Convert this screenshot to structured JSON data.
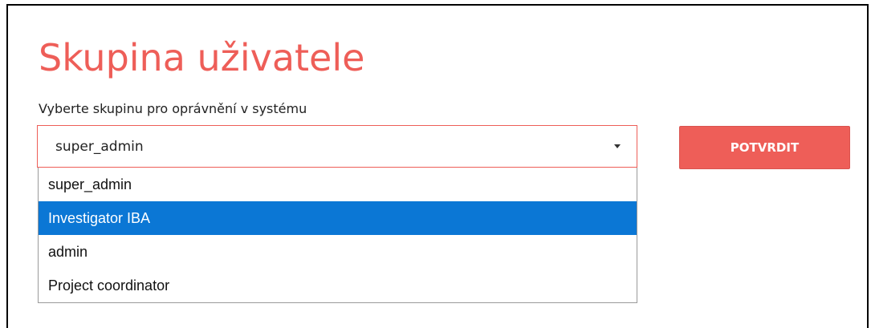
{
  "page": {
    "title": "Skupina uživatele"
  },
  "group_field": {
    "label": "Vyberte skupinu pro oprávnění v systému",
    "selected_value": "super_admin",
    "highlighted_option": "Investigator IBA",
    "options": [
      {
        "label": "super_admin"
      },
      {
        "label": "Investigator IBA"
      },
      {
        "label": "admin"
      },
      {
        "label": "Project coordinator"
      }
    ]
  },
  "actions": {
    "confirm_label": "POTVRDIT"
  },
  "colors": {
    "accent": "#ee5e58",
    "highlight": "#0b77d5",
    "text": "#222222"
  }
}
